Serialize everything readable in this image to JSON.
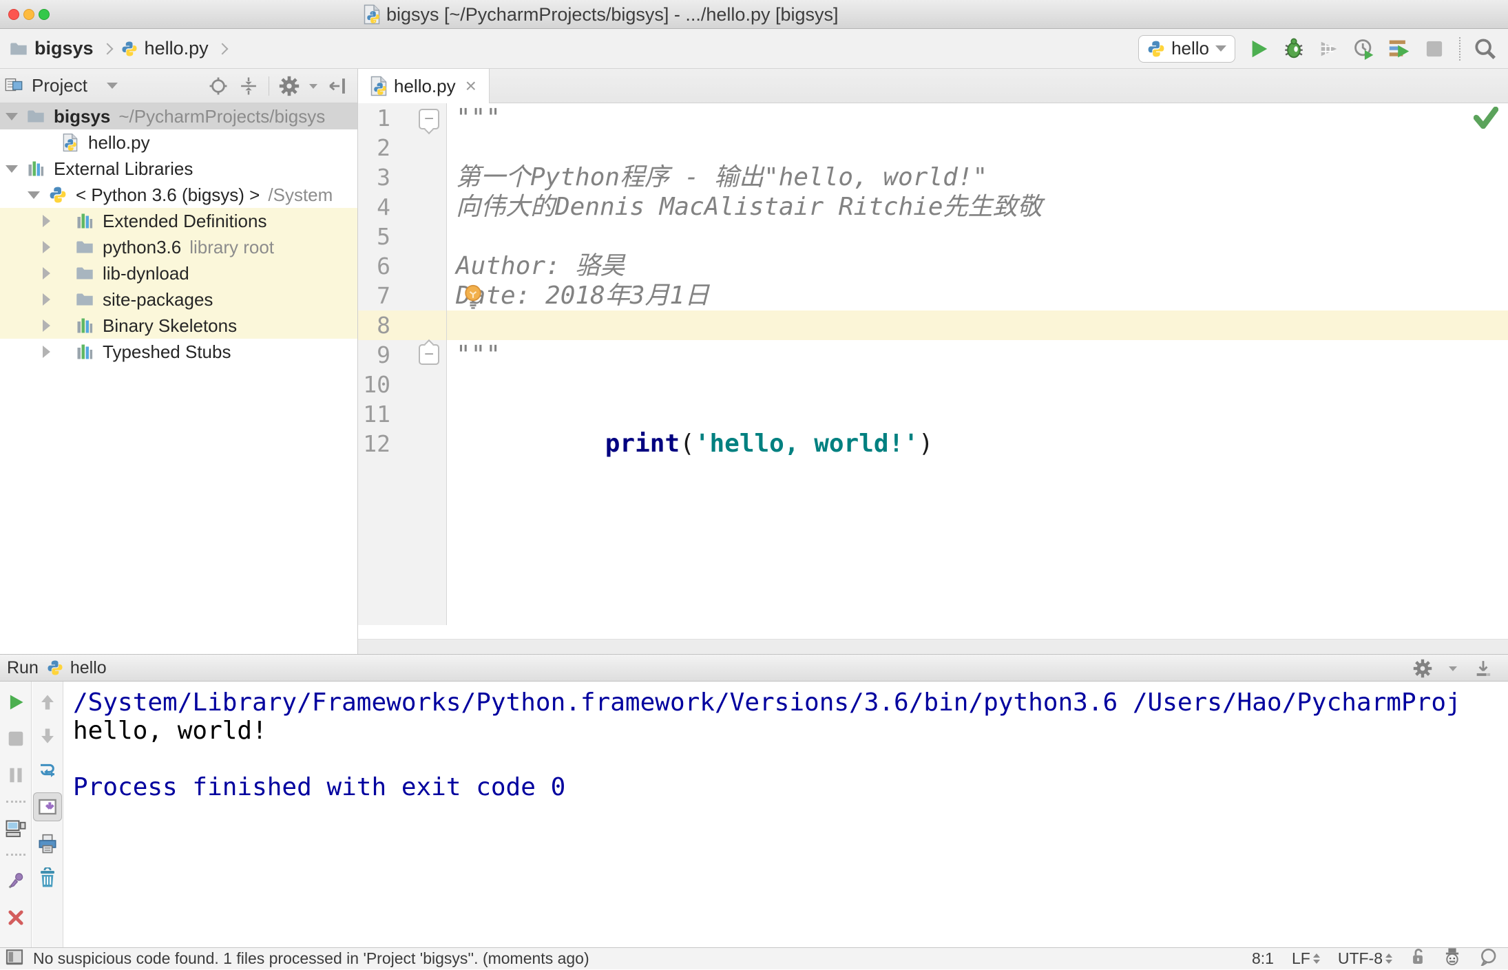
{
  "colors": {
    "run_green": "#4caf50",
    "keyword_blue": "#000080",
    "string_teal": "#008080",
    "console_info_blue": "#00009e",
    "tree_highlight_yellow": "#fbf7da",
    "editor_caret_line_yellow": "#fbf5d7",
    "selection_gray": "#d4d4d4"
  },
  "window": {
    "title": "bigsys [~/PycharmProjects/bigsys] - .../hello.py [bigsys]"
  },
  "toolbar": {
    "breadcrumbs": [
      {
        "label": "bigsys"
      },
      {
        "label": "hello.py"
      }
    ],
    "run_config": "hello"
  },
  "project": {
    "header_title": "Project",
    "tree": [
      {
        "label": "bigsys",
        "hint": "~/PycharmProjects/bigsys"
      },
      {
        "label": "hello.py",
        "hint": ""
      },
      {
        "label": "External Libraries",
        "hint": ""
      },
      {
        "label": "< Python 3.6 (bigsys) >",
        "hint": "/System"
      },
      {
        "label": "Extended Definitions",
        "hint": ""
      },
      {
        "label": "python3.6",
        "hint": "library root"
      },
      {
        "label": "lib-dynload",
        "hint": ""
      },
      {
        "label": "site-packages",
        "hint": ""
      },
      {
        "label": "Binary Skeletons",
        "hint": ""
      },
      {
        "label": "Typeshed Stubs",
        "hint": ""
      }
    ]
  },
  "editor": {
    "tab": "hello.py",
    "tab_close": "×",
    "line_numbers": [
      "1",
      "2",
      "3",
      "4",
      "5",
      "6",
      "7",
      "8",
      "9",
      "10",
      "11",
      "12"
    ],
    "code": {
      "l1": "\"\"\"",
      "l3": "第一个Python程序 - 输出\"hello, world!\"",
      "l4": "向伟大的Dennis MacAlistair Ritchie先生致敬",
      "l6": "Author: 骆昊",
      "l7": "Date: 2018年3月1日",
      "l9": "\"\"\"",
      "l11": {
        "keyword": "print",
        "open": "(",
        "string": "'hello, world!'",
        "close": ")"
      }
    }
  },
  "run_panel": {
    "title": "Run",
    "config_name": "hello",
    "more_label": "»",
    "console": {
      "l1": "/System/Library/Frameworks/Python.framework/Versions/3.6/bin/python3.6 /Users/Hao/PycharmProj",
      "l2": "hello, world!",
      "l4": "Process finished with exit code 0"
    }
  },
  "status_bar": {
    "message": "No suspicious code found. 1 files processed in 'Project 'bigsys''. (moments ago)",
    "caret": "8:1",
    "line_separator": "LF",
    "encoding": "UTF-8"
  }
}
